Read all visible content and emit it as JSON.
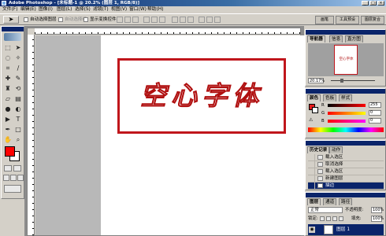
{
  "titlebar": {
    "title": "Adobe Photoshop - [未标题-1 @ 20.2% (图层 1, RGB/8)]",
    "minimize": "_",
    "maximize": "□",
    "close": "×"
  },
  "menu": [
    "文件(F)",
    "编辑(E)",
    "图像(I)",
    "图层(L)",
    "选择(S)",
    "滤镜(T)",
    "视图(V)",
    "窗口(W)",
    "帮助(H)"
  ],
  "options_bar": {
    "auto_select_layer": "自动选择图层",
    "auto_select_group": "自动选择组",
    "show_transform": "显示变换控件",
    "dock_tabs": [
      "画笔",
      "工具预设",
      "图层复合"
    ]
  },
  "canvas": {
    "text": "空心字体",
    "stroke_color": "#b01010",
    "frame_color": "#c0161c"
  },
  "navigator": {
    "tabs": [
      "导航器",
      "信息",
      "直方图"
    ],
    "zoom": "20.17%"
  },
  "color_panel": {
    "tabs": [
      "颜色",
      "色板",
      "样式"
    ],
    "channels": [
      {
        "label": "R",
        "value": "255"
      },
      {
        "label": "G",
        "value": "0"
      },
      {
        "label": "B",
        "value": "0"
      }
    ],
    "foreground": "#e41c1c"
  },
  "history": {
    "tabs": [
      "历史记录",
      "动作"
    ],
    "items": [
      "载入选区",
      "取消选择",
      "载入选区",
      "新建图层",
      "描边"
    ]
  },
  "layers": {
    "tabs": [
      "图层",
      "通道",
      "路径"
    ],
    "blend_mode": "正常",
    "opacity_label": "不透明度:",
    "opacity": "100%",
    "lock_label": "锁定:",
    "fill_label": "填充:",
    "fill": "100%",
    "layer_name": "图层 1"
  }
}
